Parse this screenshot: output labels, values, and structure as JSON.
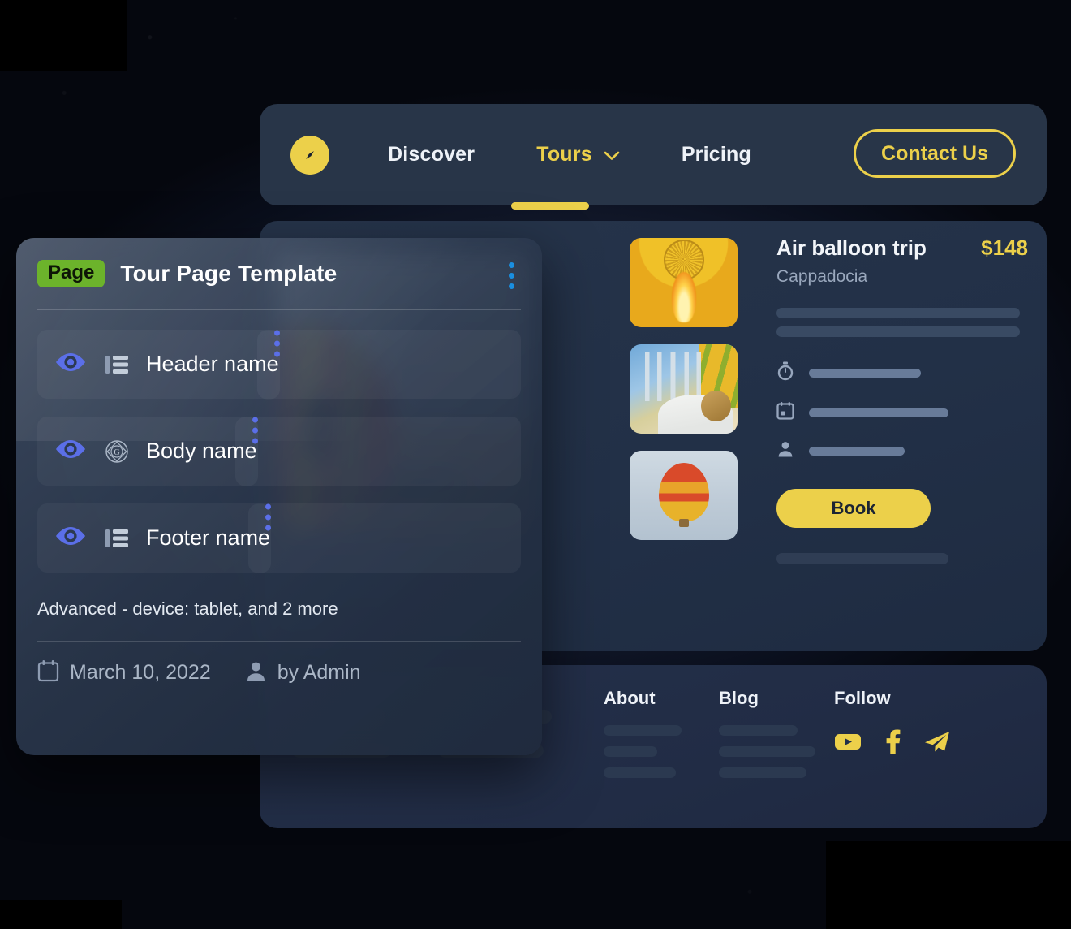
{
  "theme": {
    "accent_yellow": "#ecd04a",
    "badge_green": "#6cb32b",
    "kebab_head_blue": "#1a8fe0",
    "kebab_row_blue": "#5b6fe8",
    "eye_blue": "#5b6fe8",
    "panel_navy": "#283548",
    "page_bg": "#0a0f1d"
  },
  "navbar": {
    "logo_icon": "compass-icon",
    "links": [
      {
        "label": "Discover",
        "active": false,
        "has_dropdown": false
      },
      {
        "label": "Tours",
        "active": true,
        "has_dropdown": true,
        "dropdown_icon": "chevron-down-icon"
      },
      {
        "label": "Pricing",
        "active": false,
        "has_dropdown": false
      }
    ],
    "contact_button": "Contact Us"
  },
  "product": {
    "title": "Air balloon trip",
    "price": "$148",
    "location": "Cappadocia",
    "book_button": "Book",
    "detail_rows": [
      {
        "icon": "stopwatch-icon"
      },
      {
        "icon": "calendar-icon"
      },
      {
        "icon": "person-icon"
      }
    ],
    "gallery": {
      "main_image_alt": "red-green-yellow-hot-air-balloon-over-field",
      "thumbnails": [
        "balloon-envelope-with-burner-flame",
        "burner-rig-and-passenger-in-basket",
        "orange-hot-air-balloon-in-sky"
      ]
    }
  },
  "footer": {
    "columns": [
      {
        "title": "About",
        "placeholder_bars": 3
      },
      {
        "title": "Blog",
        "placeholder_bars": 3
      },
      {
        "title": "Follow",
        "socials": [
          "youtube-icon",
          "facebook-icon",
          "telegram-icon"
        ]
      }
    ]
  },
  "card": {
    "badge": "Page",
    "title": "Tour Page Template",
    "menu_icon": "kebab-menu-icon",
    "rows": [
      {
        "label": "Header name",
        "visibility_icon": "eye-icon",
        "type_icon": "layout-list-icon",
        "menu_icon": "kebab-menu-icon"
      },
      {
        "label": "Body name",
        "visibility_icon": "eye-icon",
        "type_icon": "global-badge-icon",
        "menu_icon": "kebab-menu-icon"
      },
      {
        "label": "Footer name",
        "visibility_icon": "eye-icon",
        "type_icon": "layout-list-icon",
        "menu_icon": "kebab-menu-icon"
      }
    ],
    "note": "Advanced - device: tablet, and 2 more",
    "meta": {
      "date_icon": "calendar-icon",
      "date": "March 10, 2022",
      "author_icon": "person-icon",
      "author": "by Admin"
    }
  }
}
